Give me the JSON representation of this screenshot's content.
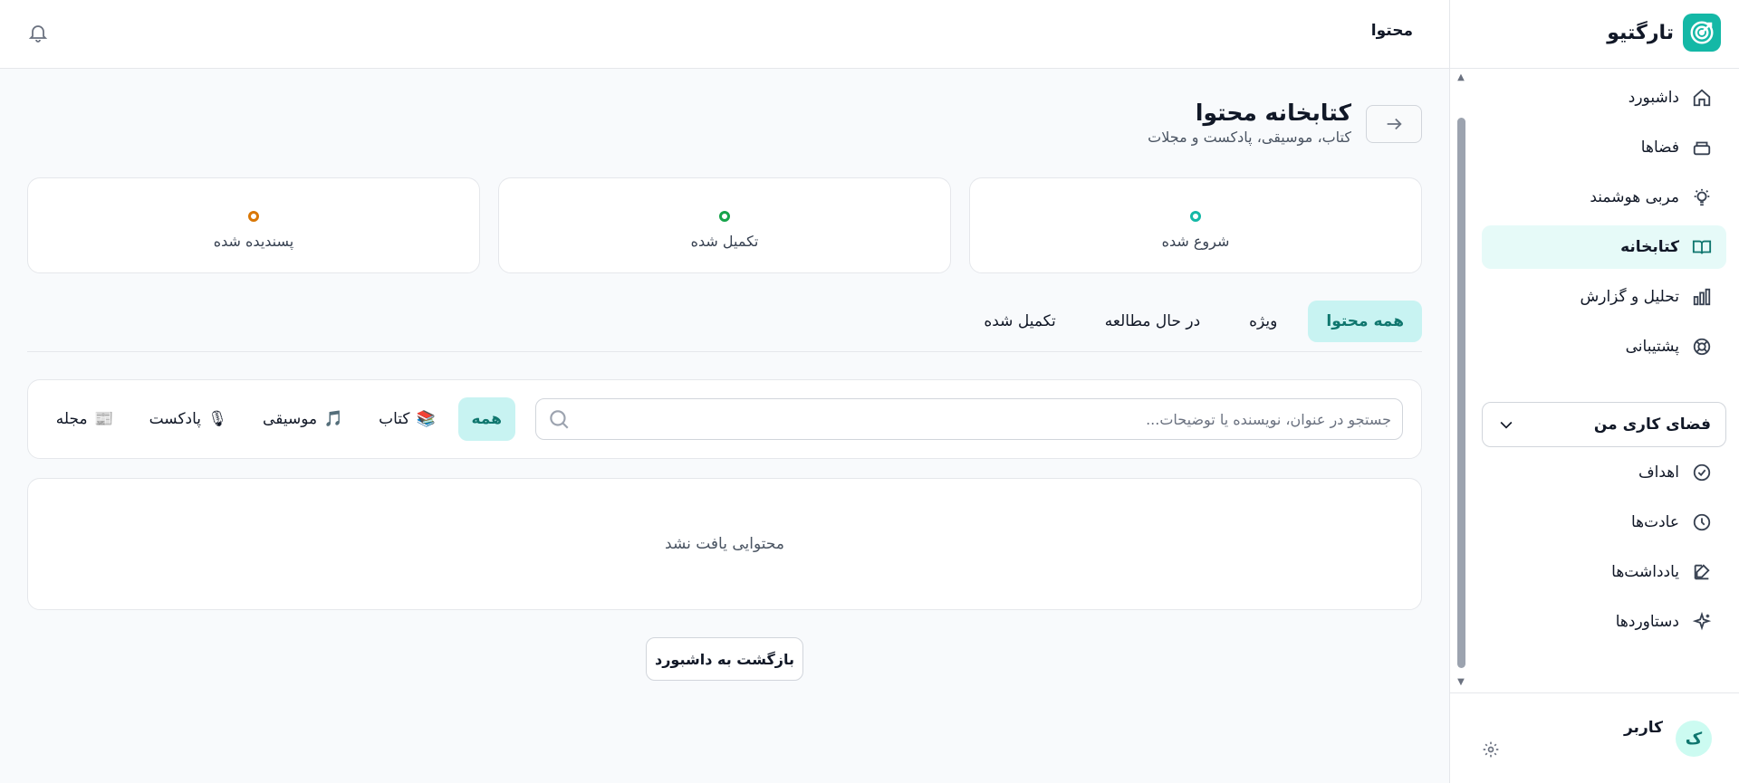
{
  "brand": {
    "name": "تارگتیو"
  },
  "topbar": {
    "title": "محتوا"
  },
  "sidebar": {
    "items": [
      {
        "label": "داشبورد",
        "icon": "home-icon"
      },
      {
        "label": "فضاها",
        "icon": "layers-icon"
      },
      {
        "label": "مربی هوشمند",
        "icon": "lightbulb-icon"
      },
      {
        "label": "کتابخانه",
        "icon": "book-open-icon",
        "active": true
      },
      {
        "label": "تحلیل و گزارش",
        "icon": "bar-chart-icon"
      },
      {
        "label": "پشتیبانی",
        "icon": "lifebuoy-icon"
      }
    ],
    "workspace_label": "فضای کاری من",
    "workspace_items": [
      {
        "label": "اهداف",
        "icon": "check-circle-icon"
      },
      {
        "label": "عادت‌ها",
        "icon": "clock-icon"
      },
      {
        "label": "یادداشت‌ها",
        "icon": "edit-icon"
      },
      {
        "label": "دستاوردها",
        "icon": "sparkles-icon"
      }
    ],
    "user": {
      "name": "کاربر",
      "initial": "ک"
    }
  },
  "page": {
    "title": "کتابخانه محتوا",
    "subtitle": "کتاب، موسیقی، پادکست و مجلات"
  },
  "stats": [
    {
      "label": "شروع شده",
      "color": "#14b8a6"
    },
    {
      "label": "تکمیل شده",
      "color": "#16a34a"
    },
    {
      "label": "پسندیده شده",
      "color": "#d97706"
    }
  ],
  "tabs": [
    {
      "label": "همه محتوا",
      "active": true
    },
    {
      "label": "ویژه"
    },
    {
      "label": "در حال مطالعه"
    },
    {
      "label": "تکمیل شده"
    }
  ],
  "search": {
    "placeholder": "جستجو در عنوان، نویسنده یا توضیحات...",
    "value": ""
  },
  "filters": [
    {
      "label": "همه",
      "icon": "",
      "active": true
    },
    {
      "label": "کتاب",
      "icon": "📚"
    },
    {
      "label": "موسیقی",
      "icon": "🎵"
    },
    {
      "label": "پادکست",
      "icon": "🎙"
    },
    {
      "label": "مجله",
      "icon": "📰"
    }
  ],
  "empty_state": {
    "text": "محتوایی یافت نشد"
  },
  "back_dashboard": {
    "label": "بازگشت به داشبورد"
  },
  "colors": {
    "accent": "#14b8a6",
    "accent_bg": "#c8f3f2",
    "active_nav_bg": "#e6faf8"
  }
}
